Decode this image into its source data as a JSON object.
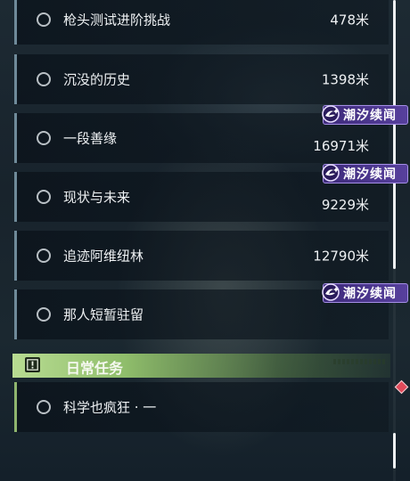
{
  "quests": [
    {
      "title": "枪头测试进阶挑战",
      "distance": "478米",
      "tag": ""
    },
    {
      "title": "沉没的历史",
      "distance": "1398米",
      "tag": ""
    },
    {
      "title": "一段善缘",
      "distance": "16971米",
      "tag": "潮汐续闻"
    },
    {
      "title": "现状与未来",
      "distance": "9229米",
      "tag": "潮汐续闻"
    },
    {
      "title": "追迹阿维纽林",
      "distance": "12790米",
      "tag": ""
    },
    {
      "title": "那人短暂驻留",
      "distance": "",
      "tag": "潮汐续闻"
    }
  ],
  "daily_section": {
    "title": "日常任务",
    "icon": "exclamation-icon",
    "quests": [
      {
        "title": "科学也疯狂 · 一",
        "marker": "red-diamond-icon"
      }
    ]
  },
  "colors": {
    "tag_purple": "#57409d",
    "section_green": "#b8dc92",
    "diamond_red": "#e04a5a"
  }
}
